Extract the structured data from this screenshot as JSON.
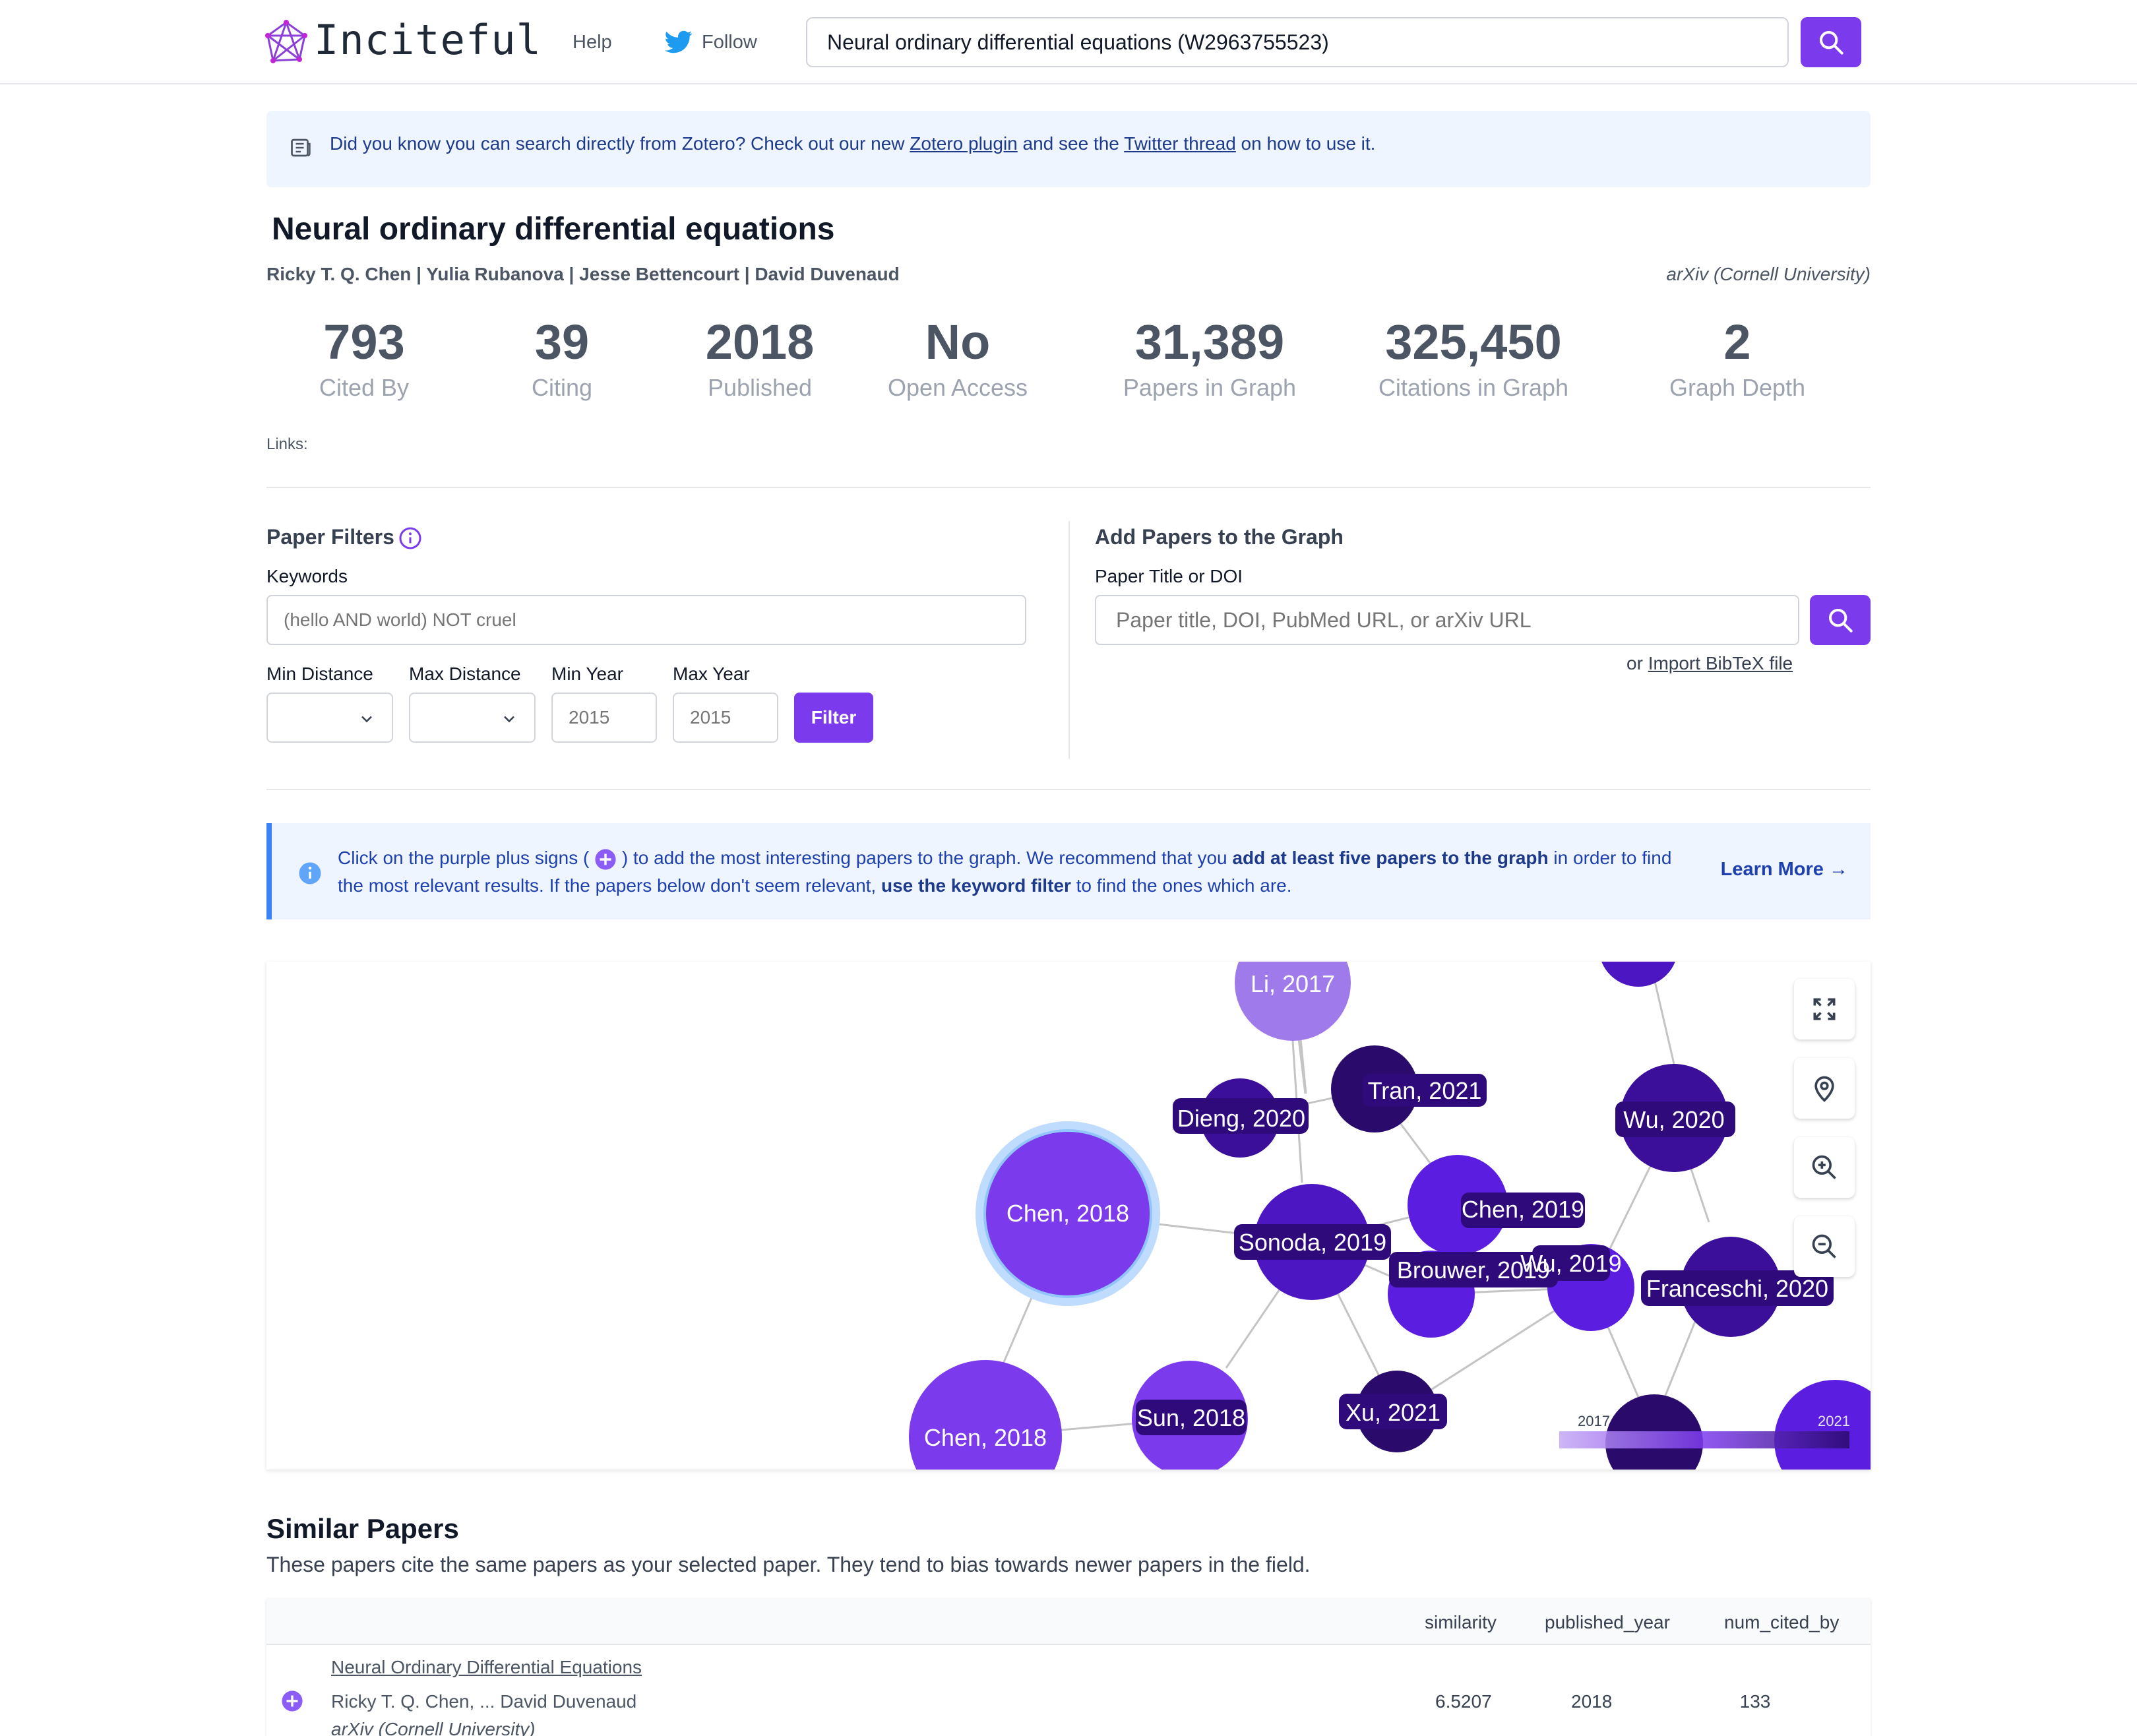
{
  "header": {
    "logo_text": "Inciteful",
    "help": "Help",
    "follow": "Follow",
    "search_value": "Neural ordinary differential equations (W2963755523)"
  },
  "banner": {
    "text_before": "Did you know you can search directly from Zotero? Check out our new ",
    "link1": "Zotero plugin",
    "text_middle": " and see the ",
    "link2": "Twitter thread",
    "text_after": " on how to use it."
  },
  "paper": {
    "title": "Neural ordinary differential equations",
    "authors": "Ricky T. Q. Chen | Yulia Rubanova | Jesse Bettencourt | David Duvenaud",
    "venue": "arXiv (Cornell University)"
  },
  "stats": [
    {
      "value": "793",
      "label": "Cited By"
    },
    {
      "value": "39",
      "label": "Citing"
    },
    {
      "value": "2018",
      "label": "Published"
    },
    {
      "value": "No",
      "label": "Open Access"
    },
    {
      "value": "31,389",
      "label": "Papers in Graph"
    },
    {
      "value": "325,450",
      "label": "Citations in Graph"
    },
    {
      "value": "2",
      "label": "Graph Depth"
    }
  ],
  "links_label": "Links:",
  "filters": {
    "title": "Paper Filters",
    "keywords_label": "Keywords",
    "keywords_placeholder": "(hello AND world) NOT cruel",
    "min_distance_label": "Min Distance",
    "max_distance_label": "Max Distance",
    "min_year_label": "Min Year",
    "max_year_label": "Max Year",
    "min_year_placeholder": "2015",
    "max_year_placeholder": "2015",
    "filter_button": "Filter"
  },
  "add_papers": {
    "title": "Add Papers to the Graph",
    "field_label": "Paper Title or DOI",
    "placeholder": "Paper title, DOI, PubMed URL, or arXiv URL",
    "or_text": "or ",
    "import_link": "Import BibTeX file"
  },
  "info": {
    "t1": "Click on the purple plus signs ( ",
    "t2": " ) to add the most interesting papers to the graph. We recommend that you ",
    "b1": "add at least five papers to the graph",
    "t3": " in order to find the most relevant results. If the papers below don't seem relevant, ",
    "b2": "use the keyword filter",
    "t4": " to find the ones which are.",
    "learn_more": "Learn More →"
  },
  "graph": {
    "nodes": [
      {
        "label": "Li, 2017",
        "color": "#9f7aea"
      },
      {
        "label": "Dieng, 2020",
        "color": "#3b0f99"
      },
      {
        "label": "Tran, 2021",
        "color": "#2a0a6b"
      },
      {
        "label": "Wu, 2020",
        "color": "#3b0f99"
      },
      {
        "label": "Chen, 2018",
        "color": "#7c3aed"
      },
      {
        "label": "Chen, 2019",
        "color": "#5b1ee0"
      },
      {
        "label": "Sonoda, 2019",
        "color": "#4c16c2"
      },
      {
        "label": "Brouwer, 2019",
        "color": "#5b1ee0"
      },
      {
        "label": "Wu, 2019",
        "color": "#5b1ee0"
      },
      {
        "label": "Franceschi, 2020",
        "color": "#3b0f99"
      },
      {
        "label": "Chen, 2018",
        "color": "#7c3aed"
      },
      {
        "label": "Sun, 2018",
        "color": "#7c3aed"
      },
      {
        "label": "Xu, 2021",
        "color": "#2a0a6b"
      }
    ],
    "legend_min": "2017",
    "legend_max": "2021"
  },
  "similar": {
    "title": "Similar Papers",
    "subtitle": "These papers cite the same papers as your selected paper. They tend to bias towards newer papers in the field.",
    "columns": [
      "similarity",
      "published_year",
      "num_cited_by"
    ],
    "rows": [
      {
        "title": "Neural Ordinary Differential Equations",
        "authors": "Ricky T. Q. Chen, ... David Duvenaud",
        "venue": "arXiv (Cornell University)",
        "similarity": "6.5207",
        "published_year": "2018",
        "num_cited_by": "133"
      }
    ]
  },
  "colors": {
    "accent": "#7c3aed",
    "banner_bg": "#eef5ff",
    "info_border": "#3b82f6"
  }
}
